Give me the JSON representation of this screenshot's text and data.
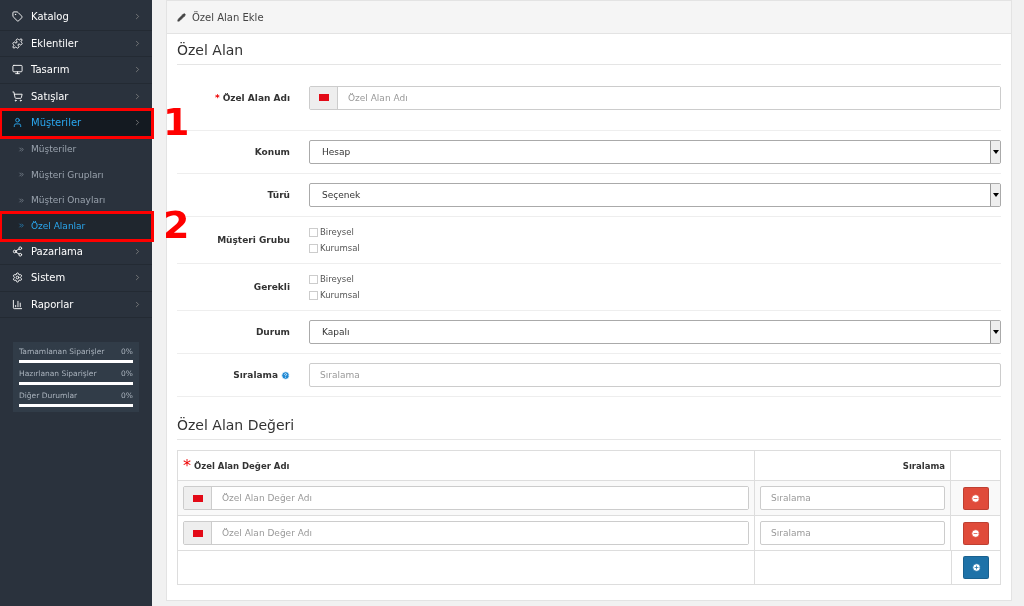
{
  "sidebar": {
    "menu": [
      {
        "label": "Katalog",
        "selected": false
      },
      {
        "label": "Eklentiler",
        "selected": false
      },
      {
        "label": "Tasarım",
        "selected": false
      },
      {
        "label": "Satışlar",
        "selected": false
      },
      {
        "label": "Müşteriler",
        "selected": true,
        "annotation": "1",
        "children": [
          {
            "label": "Müşteriler",
            "selected": false
          },
          {
            "label": "Müşteri Grupları",
            "selected": false
          },
          {
            "label": "Müşteri Onayları",
            "selected": false
          },
          {
            "label": "Özel Alanlar",
            "selected": true,
            "annotation": "2"
          }
        ]
      },
      {
        "label": "Pazarlama",
        "selected": false
      },
      {
        "label": "Sistem",
        "selected": false
      },
      {
        "label": "Raporlar",
        "selected": false
      }
    ],
    "stats": [
      {
        "label": "Tamamlanan Siparişler",
        "value": "0%",
        "level": 0
      },
      {
        "label": "Hazırlanan Siparişler",
        "value": "0%",
        "level": 0
      },
      {
        "label": "Diğer Durumlar",
        "value": "0%",
        "level": 0
      }
    ]
  },
  "panel": {
    "title": "Özel Alan Ekle",
    "section": "Özel Alan",
    "fields": [
      {
        "kind": "lang-text",
        "label": "Özel Alan Adı",
        "required_mark": "*",
        "placeholder": "Özel Alan Adı"
      },
      {
        "kind": "select",
        "label": "Konum",
        "value": "Hesap"
      },
      {
        "kind": "select",
        "label": "Türü",
        "value": "Seçenek"
      },
      {
        "kind": "checkboxes",
        "label": "Müşteri Grubu",
        "options": [
          {
            "label": "Bireysel",
            "checked": false
          },
          {
            "label": "Kurumsal",
            "checked": false
          }
        ]
      },
      {
        "kind": "checkboxes",
        "label": "Gerekli",
        "options": [
          {
            "label": "Bireysel",
            "checked": false
          },
          {
            "label": "Kurumsal",
            "checked": false
          }
        ]
      },
      {
        "kind": "select",
        "label": "Durum",
        "value": "Kapalı"
      },
      {
        "kind": "text",
        "label": "Sıralama",
        "help": true,
        "placeholder": "Sıralama"
      }
    ],
    "values_section": "Özel Alan Değeri",
    "values_table": {
      "columns": [
        {
          "label": "Özel Alan Değer Adı",
          "required_mark": "*"
        },
        {
          "label": "Sıralama"
        }
      ],
      "rows": [
        {
          "name_placeholder": "Özel Alan Değer Adı",
          "sort_placeholder": "Sıralama"
        },
        {
          "name_placeholder": "Özel Alan Değer Adı",
          "sort_placeholder": "Sıralama"
        }
      ]
    }
  }
}
